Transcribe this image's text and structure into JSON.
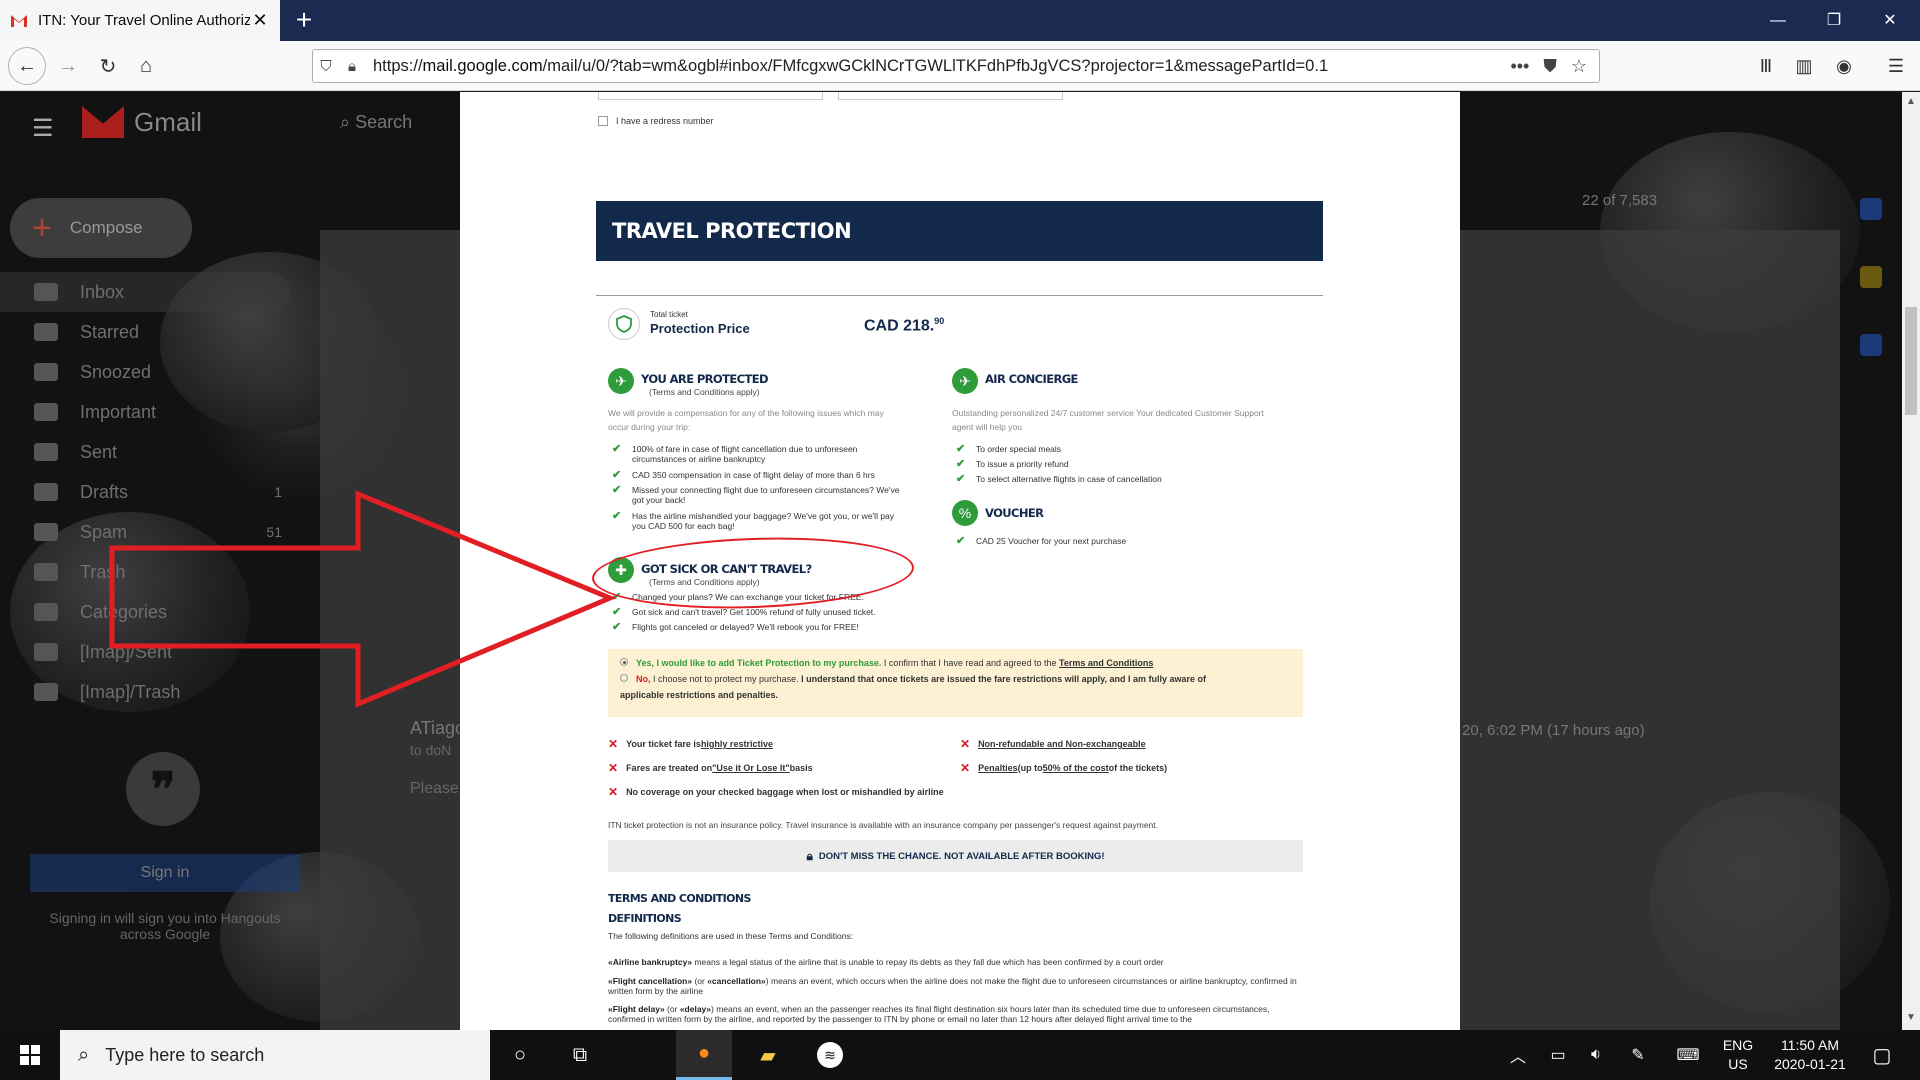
{
  "browser": {
    "tab_title": "ITN: Your Travel Online Authoriz",
    "new_tab": "+",
    "url_domain": "mail.google.com",
    "url_prefix": "https://",
    "url_path": "/mail/u/0/?tab=wm&ogbl#inbox/FMfcgxwGCklNCrTGWLlTKFdhPfbJgVCS?projector=1&messagePartId=0.1",
    "more": "•••"
  },
  "gmail": {
    "logo_text": "Gmail",
    "search": "Search",
    "compose": "Compose",
    "nav": [
      {
        "label": "Inbox",
        "count": ""
      },
      {
        "label": "Starred",
        "count": ""
      },
      {
        "label": "Snoozed",
        "count": ""
      },
      {
        "label": "Important",
        "count": ""
      },
      {
        "label": "Sent",
        "count": ""
      },
      {
        "label": "Drafts",
        "count": "1"
      },
      {
        "label": "Spam",
        "count": "51"
      },
      {
        "label": "Trash",
        "count": ""
      },
      {
        "label": "Categories",
        "count": ""
      },
      {
        "label": "[Imap]/Sent",
        "count": ""
      },
      {
        "label": "[Imap]/Trash",
        "count": ""
      }
    ],
    "pager": "22 of 7,583",
    "email_from": "ATiago",
    "email_to": "to doN",
    "email_body": "Please",
    "email_time": "20, 6:02 PM (17 hours ago)",
    "signin": "Sign in",
    "signin_text": "Signing in will sign you into Hangouts across Google",
    "hangout_glyph": "❞"
  },
  "doc": {
    "redress": "I have a redress number",
    "banner": "TRAVEL PROTECTION",
    "price_small": "Total ticket",
    "price_label": "Protection Price",
    "price_value": "CAD 218.",
    "price_cents": "90",
    "protected": {
      "title": "YOU ARE PROTECTED",
      "sub": "(Terms and Conditions apply)",
      "desc1": "We will provide a compensation for any of the following issues which may",
      "desc2": "occur during your trip:",
      "items": [
        [
          "100% of fare in case of flight cancellation due to unforeseen",
          "circumstances or airline bankruptcy"
        ],
        [
          "CAD 350 compensation in case of flight delay of more than 6 hrs",
          ""
        ],
        [
          "Missed your connecting flight due to unforeseen circumstances? We've",
          "got your back!"
        ],
        [
          "Has the airline mishandled your baggage? We've got you, or we'll pay",
          "you CAD 500 for each bag!"
        ]
      ]
    },
    "concierge": {
      "title": "AIR CONCIERGE",
      "desc1": "Outstanding personalized 24/7 customer service Your dedicated Customer Support",
      "desc2": "agent will help you",
      "items": [
        "To order special meals",
        "To issue a priority refund",
        "To select alternative flights in case of cancellation"
      ]
    },
    "voucher": {
      "title": "VOUCHER",
      "items": [
        "CAD 25 Voucher for your next purchase"
      ]
    },
    "sick": {
      "title": "GOT SICK OR CAN'T TRAVEL?",
      "sub": "(Terms and Conditions apply)",
      "items": [
        "Changed your plans? We can exchange your ticket for FREE.",
        "Got sick and can't travel? Get 100% refund of fully unused ticket.",
        "Flights got canceled or delayed? We'll rebook you for FREE!"
      ]
    },
    "choice": {
      "yes_label": "Yes, I would like to add Ticket Protection to my purchase.",
      "yes_rest": " I confirm that I have read and agreed to the ",
      "terms_link": "Terms and Conditions",
      "no_label": "No,",
      "no_rest": " I choose not to protect my purchase. ",
      "no_bold": "I understand that once tickets are issued the fare restrictions will apply, and I am fully aware of",
      "no_bold2": "applicable restrictions and penalties."
    },
    "risks": {
      "r1a": "Your ticket fare is ",
      "r1b": "highly restrictive",
      "r2a": "Fares are treated on ",
      "r2b": "\"Use it Or Lose It\"",
      "r2c": " basis",
      "r3": "No coverage on your checked baggage when lost or mishandled by airline",
      "r4": "Non-refundable and Non-exchangeable",
      "r5a": "Penalties",
      "r5b": " (up to ",
      "r5c": "50% of the cost",
      "r5d": " of the tickets)"
    },
    "disclaimer": "ITN ticket protection is not an insurance policy. Travel insurance is available with an insurance company per passenger's request against payment.",
    "chance": "DON'T MISS THE CHANCE. NOT AVAILABLE AFTER BOOKING!",
    "tc_title": "TERMS AND CONDITIONS",
    "def_title": "DEFINITIONS",
    "def_intro": "The following definitions are used in these Terms and Conditions:",
    "def1_term": "«Airline bankruptcy»",
    "def1_text": " means a legal status of the airline that is unable to repay its debts as they fall due which has been confirmed by a court order",
    "def2_term": "«Flight cancellation»",
    "def2_mid": " (or ",
    "def2_term2": "«cancellation»",
    "def2_text": ") means an event, which occurs when the airline does not make the flight due to unforeseen circumstances or airline bankruptcy, confirmed in written form by the airline",
    "def3_term": "«Flight delay»",
    "def3_mid": " (or ",
    "def3_term2": "«delay»",
    "def3_text": ") means an event, when an the passenger reaches its final flight destination six hours later than its scheduled time due to unforeseen circumstances, confirmed in written form by the airline, and reported by the passenger to ITN by phone or email no later than 12 hours after delayed flight arrival time to the"
  },
  "taskbar": {
    "search": "Type here to search",
    "lang1": "ENG",
    "lang2": "US",
    "time": "11:50 AM",
    "date": "2020-01-21"
  },
  "colors": {
    "banner": "#13294b",
    "green": "#2e9c3b",
    "red": "#d31e24",
    "annotation": "#e01e24",
    "choice_bg": "#fcf1d2"
  }
}
